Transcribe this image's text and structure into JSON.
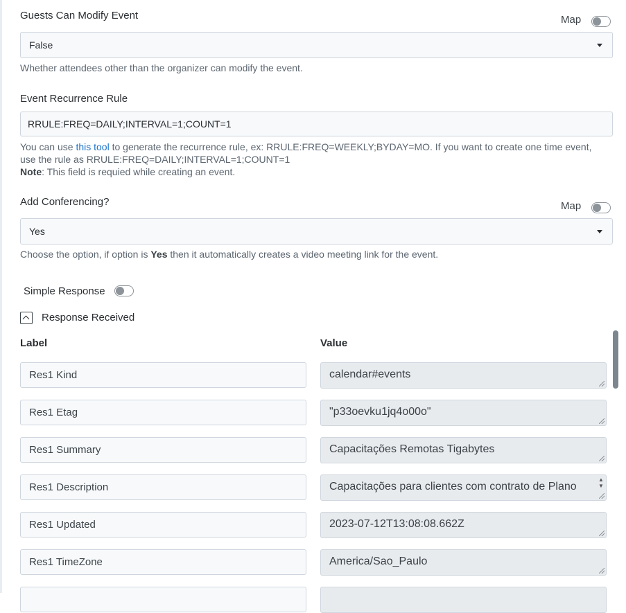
{
  "guests_modify": {
    "label": "Guests Can Modify Event",
    "map_label": "Map",
    "value": "False",
    "help": "Whether attendees other than the organizer can modify the event."
  },
  "recurrence": {
    "label": "Event Recurrence Rule",
    "value": "RRULE:FREQ=DAILY;INTERVAL=1;COUNT=1",
    "help_prefix": "You can use ",
    "help_link": "this tool",
    "help_line1": " to generate the recurrence rule, ex: RRULE:FREQ=WEEKLY;BYDAY=MO. If you want to create one time event,",
    "help_line2": "use the rule as RRULE:FREQ=DAILY;INTERVAL=1;COUNT=1",
    "note_label": "Note",
    "note_text": ": This field is requied while creating an event."
  },
  "conferencing": {
    "label": "Add Conferencing?",
    "map_label": "Map",
    "value": "Yes",
    "help_prefix": "Choose the option, if option is ",
    "help_bold": "Yes",
    "help_suffix": " then it automatically creates a video meeting link for the event."
  },
  "simple_response": {
    "label": "Simple Response"
  },
  "response_received": {
    "label": "Response Received"
  },
  "table": {
    "label_header": "Label",
    "value_header": "Value",
    "rows": [
      {
        "label": "Res1 Kind",
        "value": "calendar#events"
      },
      {
        "label": "Res1 Etag",
        "value": "\"p33oevku1jq4o00o\""
      },
      {
        "label": "Res1 Summary",
        "value": "Capacitações Remotas Tigabytes"
      },
      {
        "label": "Res1 Description",
        "value": "Capacitações para clientes com contrato de Plano"
      },
      {
        "label": "Res1 Updated",
        "value": "2023-07-12T13:08:08.662Z"
      },
      {
        "label": "Res1 TimeZone",
        "value": "America/Sao_Paulo"
      },
      {
        "label": "",
        "value": ""
      }
    ]
  }
}
